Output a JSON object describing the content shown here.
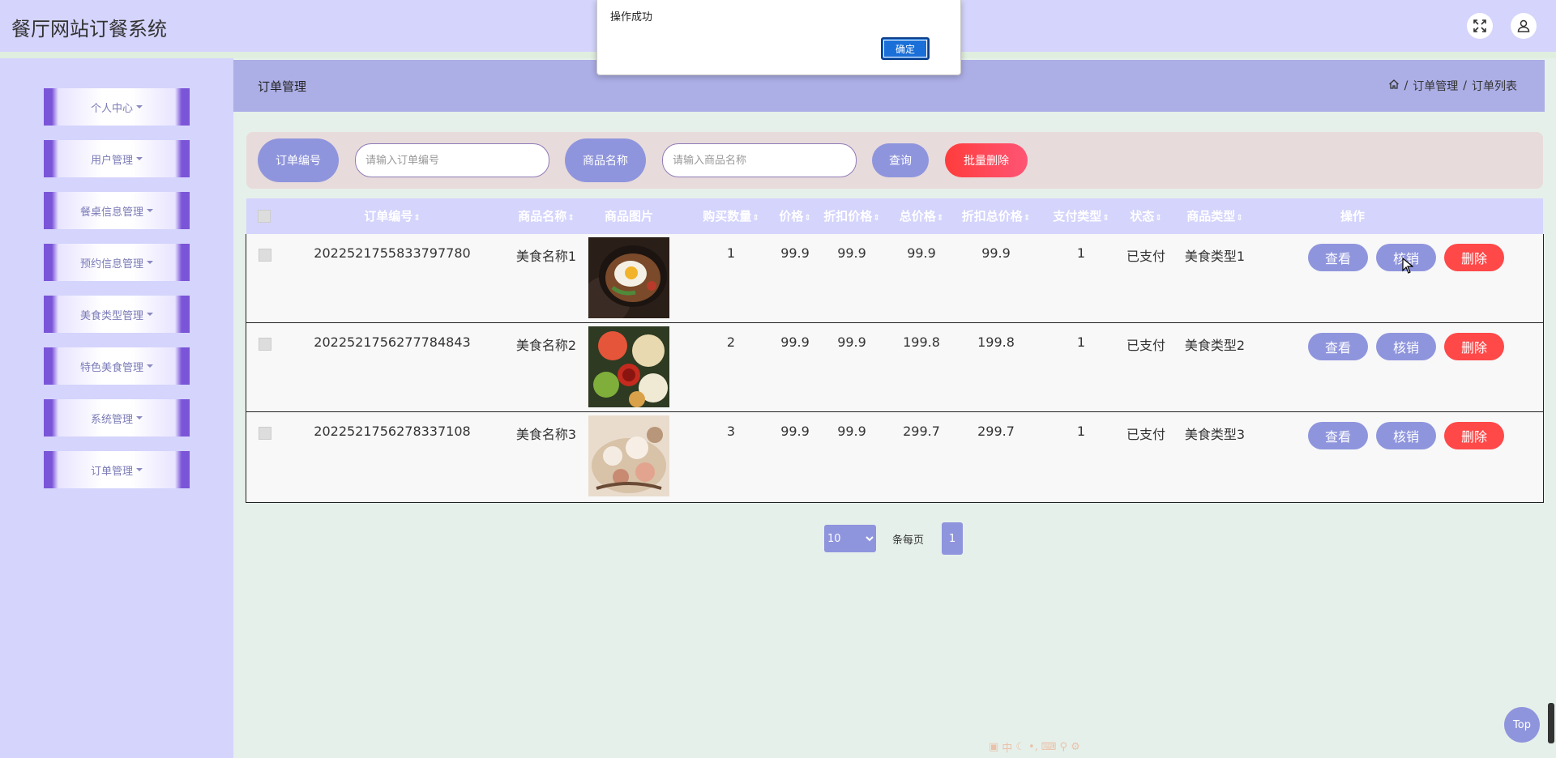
{
  "app": {
    "title": "餐厅网站订餐系统"
  },
  "header": {
    "icons": [
      "fullscreen-icon",
      "user-icon"
    ]
  },
  "sidebar": {
    "items": [
      {
        "label": "个人中心"
      },
      {
        "label": "用户管理"
      },
      {
        "label": "餐桌信息管理"
      },
      {
        "label": "预约信息管理"
      },
      {
        "label": "美食类型管理"
      },
      {
        "label": "特色美食管理"
      },
      {
        "label": "系统管理"
      },
      {
        "label": "订单管理"
      }
    ]
  },
  "content": {
    "title": "订单管理",
    "breadcrumb": {
      "sep": "/",
      "level1": "订单管理",
      "level2": "订单列表"
    }
  },
  "search": {
    "order_label": "订单编号",
    "order_placeholder": "请输入订单编号",
    "product_label": "商品名称",
    "product_placeholder": "请输入商品名称",
    "query_label": "查询",
    "batch_delete_label": "批量删除"
  },
  "table": {
    "columns": [
      "订单编号",
      "商品名称",
      "商品图片",
      "购买数量",
      "价格",
      "折扣价格",
      "总价格",
      "折扣总价格",
      "支付类型",
      "状态",
      "商品类型",
      "操作"
    ],
    "rows": [
      {
        "order_no": "2022521755833797780",
        "name": "美食名称1",
        "qty": "1",
        "price": "99.9",
        "discount_price": "99.9",
        "total": "99.9",
        "discount_total": "99.9",
        "pay_type": "1",
        "status": "已支付",
        "category": "美食类型1"
      },
      {
        "order_no": "2022521756277784843",
        "name": "美食名称2",
        "qty": "2",
        "price": "99.9",
        "discount_price": "99.9",
        "total": "199.8",
        "discount_total": "199.8",
        "pay_type": "1",
        "status": "已支付",
        "category": "美食类型2"
      },
      {
        "order_no": "2022521756278337108",
        "name": "美食名称3",
        "qty": "3",
        "price": "99.9",
        "discount_price": "99.9",
        "total": "299.7",
        "discount_total": "299.7",
        "pay_type": "1",
        "status": "已支付",
        "category": "美食类型3"
      }
    ],
    "actions": {
      "view": "查看",
      "verify": "核销",
      "delete": "删除"
    }
  },
  "pagination": {
    "page_size": "10",
    "per_page_label": "条每页",
    "current_page": "1"
  },
  "dialog": {
    "message": "操作成功",
    "ok_label": "确定"
  },
  "top_button": {
    "label": "Top"
  },
  "ime": {
    "label": "中"
  },
  "colors": {
    "accent": "#8f95dd",
    "danger": "#ff4757",
    "header_bg": "#d4d4fc",
    "sidebar_accent": "#7b55d8"
  }
}
